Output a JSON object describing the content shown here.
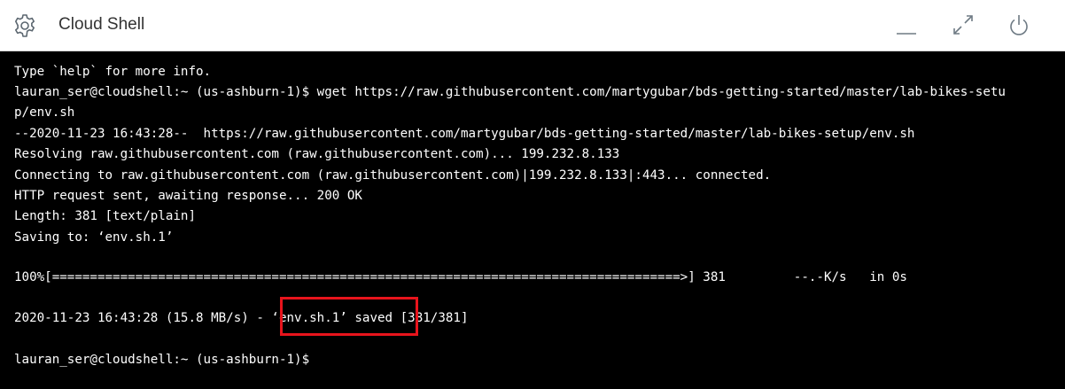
{
  "header": {
    "title": "Cloud Shell",
    "icons": {
      "settings": "gear-icon",
      "minimize": "minimize-icon",
      "maximize": "maximize-icon",
      "power": "power-icon"
    },
    "border_color": "#d6d6d6"
  },
  "terminal": {
    "background": "#000000",
    "foreground": "#ffffff",
    "highlight_color": "#e8141c",
    "lines": [
      "Type `help` for more info.",
      "lauran_ser@cloudshell:~ (us-ashburn-1)$ wget https://raw.githubusercontent.com/martygubar/bds-getting-started/master/lab-bikes-setu",
      "p/env.sh",
      "--2020-11-23 16:43:28--  https://raw.githubusercontent.com/martygubar/bds-getting-started/master/lab-bikes-setup/env.sh",
      "Resolving raw.githubusercontent.com (raw.githubusercontent.com)... 199.232.8.133",
      "Connecting to raw.githubusercontent.com (raw.githubusercontent.com)|199.232.8.133|:443... connected.",
      "HTTP request sent, awaiting response... 200 OK",
      "Length: 381 [text/plain]",
      "Saving to: ‘env.sh.1’",
      "",
      "100%[===================================================================================>] 381         --.-K/s   in 0s",
      "",
      "2020-11-23 16:43:28 (15.8 MB/s) - ‘env.sh.1’ saved [381/381]",
      "",
      "lauran_ser@cloudshell:~ (us-ashburn-1)$"
    ]
  }
}
